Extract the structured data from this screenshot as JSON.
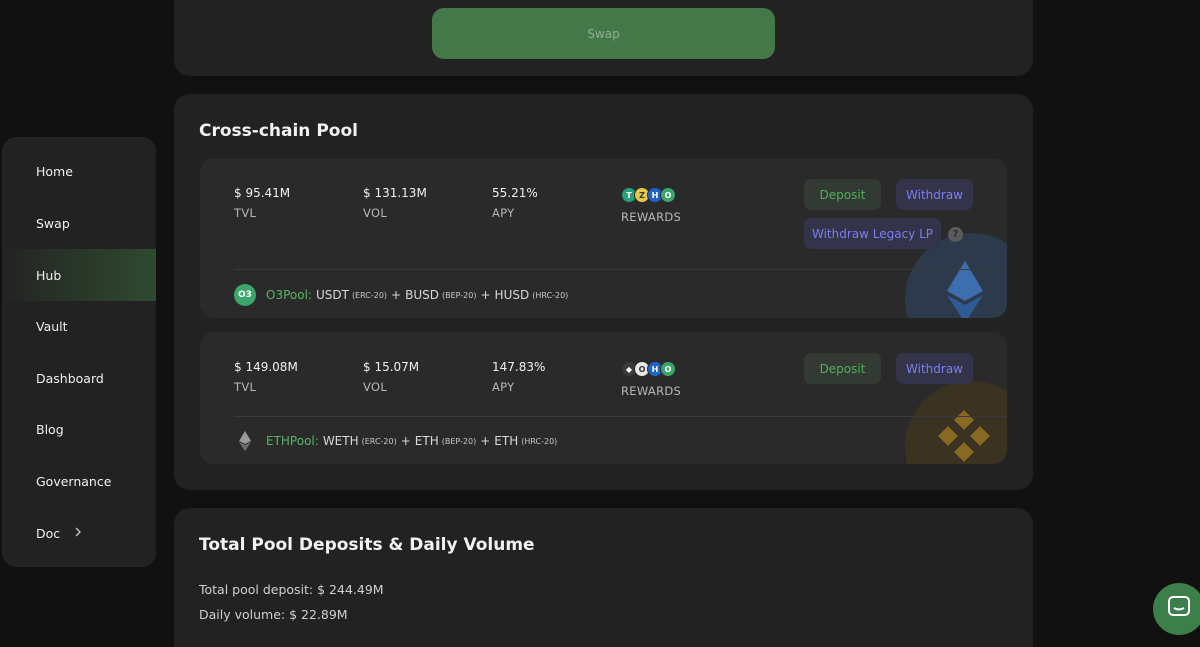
{
  "sidebar": {
    "items": [
      {
        "label": "Home"
      },
      {
        "label": "Swap"
      },
      {
        "label": "Hub",
        "active": true
      },
      {
        "label": "Vault"
      },
      {
        "label": "Dashboard"
      },
      {
        "label": "Blog"
      },
      {
        "label": "Governance"
      },
      {
        "label": "Doc",
        "icon": "chevron-right-icon"
      }
    ]
  },
  "swap_card": {
    "button_label": "Swap"
  },
  "cross_chain": {
    "title": "Cross-chain Pool",
    "pools": [
      {
        "tvl_value": "$ 95.41M",
        "tvl_label": "TVL",
        "vol_value": "$ 131.13M",
        "vol_label": "VOL",
        "apy_value": "55.21%",
        "apy_label": "APY",
        "rewards_label": "REWARDS",
        "reward_icons": [
          "tether-icon",
          "curve-icon",
          "husd-icon",
          "o3-icon"
        ],
        "deposit_label": "Deposit",
        "withdraw_label": "Withdraw",
        "legacy_label": "Withdraw Legacy LP",
        "help_label": "?",
        "pool_name": "O3Pool:",
        "tokens": [
          {
            "name": "USDT",
            "standard": "(ERC-20)"
          },
          {
            "name": "BUSD",
            "standard": "(BEP-20)"
          },
          {
            "name": "HUSD",
            "standard": "(HRC-20)"
          }
        ],
        "plus": "+",
        "background_icon": "ethereum-icon"
      },
      {
        "tvl_value": "$ 149.08M",
        "tvl_label": "TVL",
        "vol_value": "$ 15.07M",
        "vol_label": "VOL",
        "apy_value": "147.83%",
        "apy_label": "APY",
        "rewards_label": "REWARDS",
        "reward_icons": [
          "ethereum-icon",
          "o3-ring-icon",
          "husd-icon",
          "o3-icon"
        ],
        "deposit_label": "Deposit",
        "withdraw_label": "Withdraw",
        "pool_name": "ETHPool:",
        "tokens": [
          {
            "name": "WETH",
            "standard": "(ERC-20)"
          },
          {
            "name": "ETH",
            "standard": "(BEP-20)"
          },
          {
            "name": "ETH",
            "standard": "(HRC-20)"
          }
        ],
        "plus": "+",
        "background_icon": "binance-icon"
      }
    ]
  },
  "totals": {
    "title": "Total Pool Deposits & Daily Volume",
    "deposit_line": "Total pool deposit: $ 244.49M",
    "volume_line": "Daily volume: $ 22.89M"
  },
  "colors": {
    "accent_green": "#4fae5b",
    "accent_purple": "#7a7ef0",
    "card_bg": "#222222",
    "page_bg": "#111111"
  }
}
